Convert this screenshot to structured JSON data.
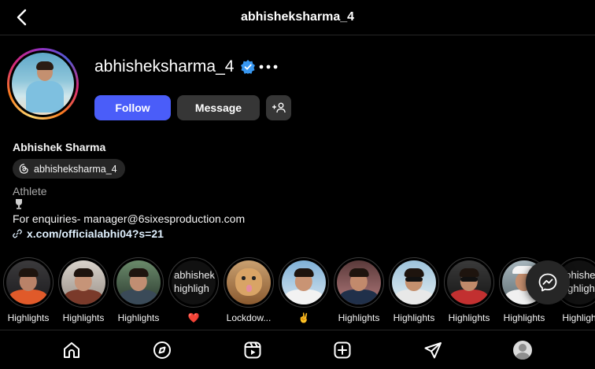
{
  "header": {
    "title": "abhisheksharma_4",
    "back_icon": "chevron-left-icon"
  },
  "profile": {
    "username": "abhisheksharma_4",
    "verified_color": "#3897f0",
    "follow_label": "Follow",
    "message_label": "Message",
    "full_name": "Abhishek Sharma",
    "threads_handle": "abhisheksharma_4",
    "category": "Athlete",
    "bio": "For enquiries- manager@6sixesproduction.com",
    "link": "x.com/officialabhi04?s=21"
  },
  "colors": {
    "follow_button": "#4a5df9",
    "secondary_button": "#363636",
    "background": "#000000"
  },
  "highlights": [
    {
      "label": "Highlights"
    },
    {
      "label": "Highlights"
    },
    {
      "label": "Highlights"
    },
    {
      "label": "❤️",
      "cover_text": "abhishek highligh"
    },
    {
      "label": "Lockdow..."
    },
    {
      "label": "✌️"
    },
    {
      "label": "Highlights"
    },
    {
      "label": "Highlights"
    },
    {
      "label": "Highlights"
    },
    {
      "label": "Highlights"
    },
    {
      "label": "Highligh",
      "cover_text": "abhishe highligh"
    }
  ],
  "bottom_nav": [
    "home-icon",
    "explore-icon",
    "reels-icon",
    "create-icon",
    "direct-icon",
    "profile-icon"
  ]
}
